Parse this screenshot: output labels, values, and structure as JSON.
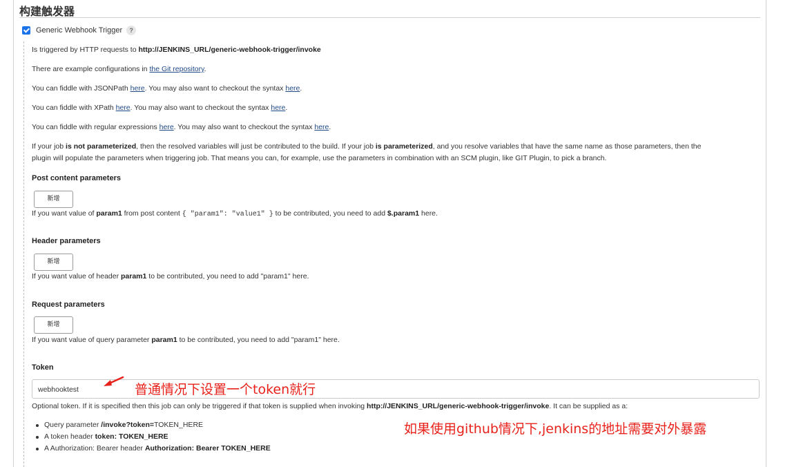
{
  "section": {
    "title": "构建触发器"
  },
  "trigger": {
    "label": "Generic Webhook Trigger",
    "help": "?"
  },
  "description": {
    "line1_pre": "Is triggered by HTTP requests to ",
    "line1_url": "http://JENKINS_URL/generic-webhook-trigger/invoke",
    "line2_pre": "There are example configurations in ",
    "line2_link": "the Git repository",
    "line2_post": ".",
    "json_pre": "You can fiddle with JSONPath ",
    "json_link": "here",
    "json_mid": ". You may also want to checkout the syntax ",
    "json_link2": "here",
    "json_post": ".",
    "xpath_pre": "You can fiddle with XPath ",
    "xpath_link": "here",
    "xpath_mid": ". You may also want to checkout the syntax ",
    "xpath_link2": "here",
    "xpath_post": ".",
    "regex_pre": "You can fiddle with regular expressions ",
    "regex_link": "here",
    "regex_mid": ". You may also want to checkout the syntax ",
    "regex_link2": "here",
    "regex_post": ".",
    "param_p1": "If your job ",
    "param_b1": "is not parameterized",
    "param_p2": ", then the resolved variables will just be contributed to the build. If your job ",
    "param_b2": "is parameterized",
    "param_p3": ", and you resolve variables that have the same name as those parameters, then the",
    "param_line2": "plugin will populate the parameters when triggering job. That means you can, for example, use the parameters in combination with an SCM plugin, like GIT Plugin, to pick a branch."
  },
  "post_params": {
    "heading": "Post content parameters",
    "add_label": "新增",
    "hint_p1": "If you want value of ",
    "hint_b1": "param1",
    "hint_p2": " from post content ",
    "hint_code": "{ \"param1\": \"value1\" }",
    "hint_p3": " to be contributed, you need to add ",
    "hint_b2": "$.param1",
    "hint_p4": " here."
  },
  "header_params": {
    "heading": "Header parameters",
    "add_label": "新增",
    "hint_p1": "If you want value of header ",
    "hint_b1": "param1",
    "hint_p2": " to be contributed, you need to add \"param1\" here."
  },
  "request_params": {
    "heading": "Request parameters",
    "add_label": "新增",
    "hint_p1": "If you want value of query parameter ",
    "hint_b1": "param1",
    "hint_p2": " to be contributed, you need to add \"param1\" here."
  },
  "token": {
    "heading": "Token",
    "value": "webhooktest",
    "hint_pre": "Optional token. If it is specified then this job can only be triggered if that token is supplied when invoking ",
    "hint_url": "http://JENKINS_URL/generic-webhook-trigger/invoke",
    "hint_post": ". It can be supplied as a:",
    "b1_pre": "Query parameter ",
    "b1_bold": "/invoke?token=",
    "b1_post": "TOKEN_HERE",
    "b2_pre": "A token header ",
    "b2_bold": "token: TOKEN_HERE",
    "b3_pre": "A Authorization: Bearer header ",
    "b3_bold": "Authorization: Bearer TOKEN_HERE"
  },
  "annotations": {
    "token_note": "普通情况下设置一个token就行",
    "github_note": "如果使用github情况下,jenkins的地址需要对外暴露",
    "color": "#e8221b"
  }
}
